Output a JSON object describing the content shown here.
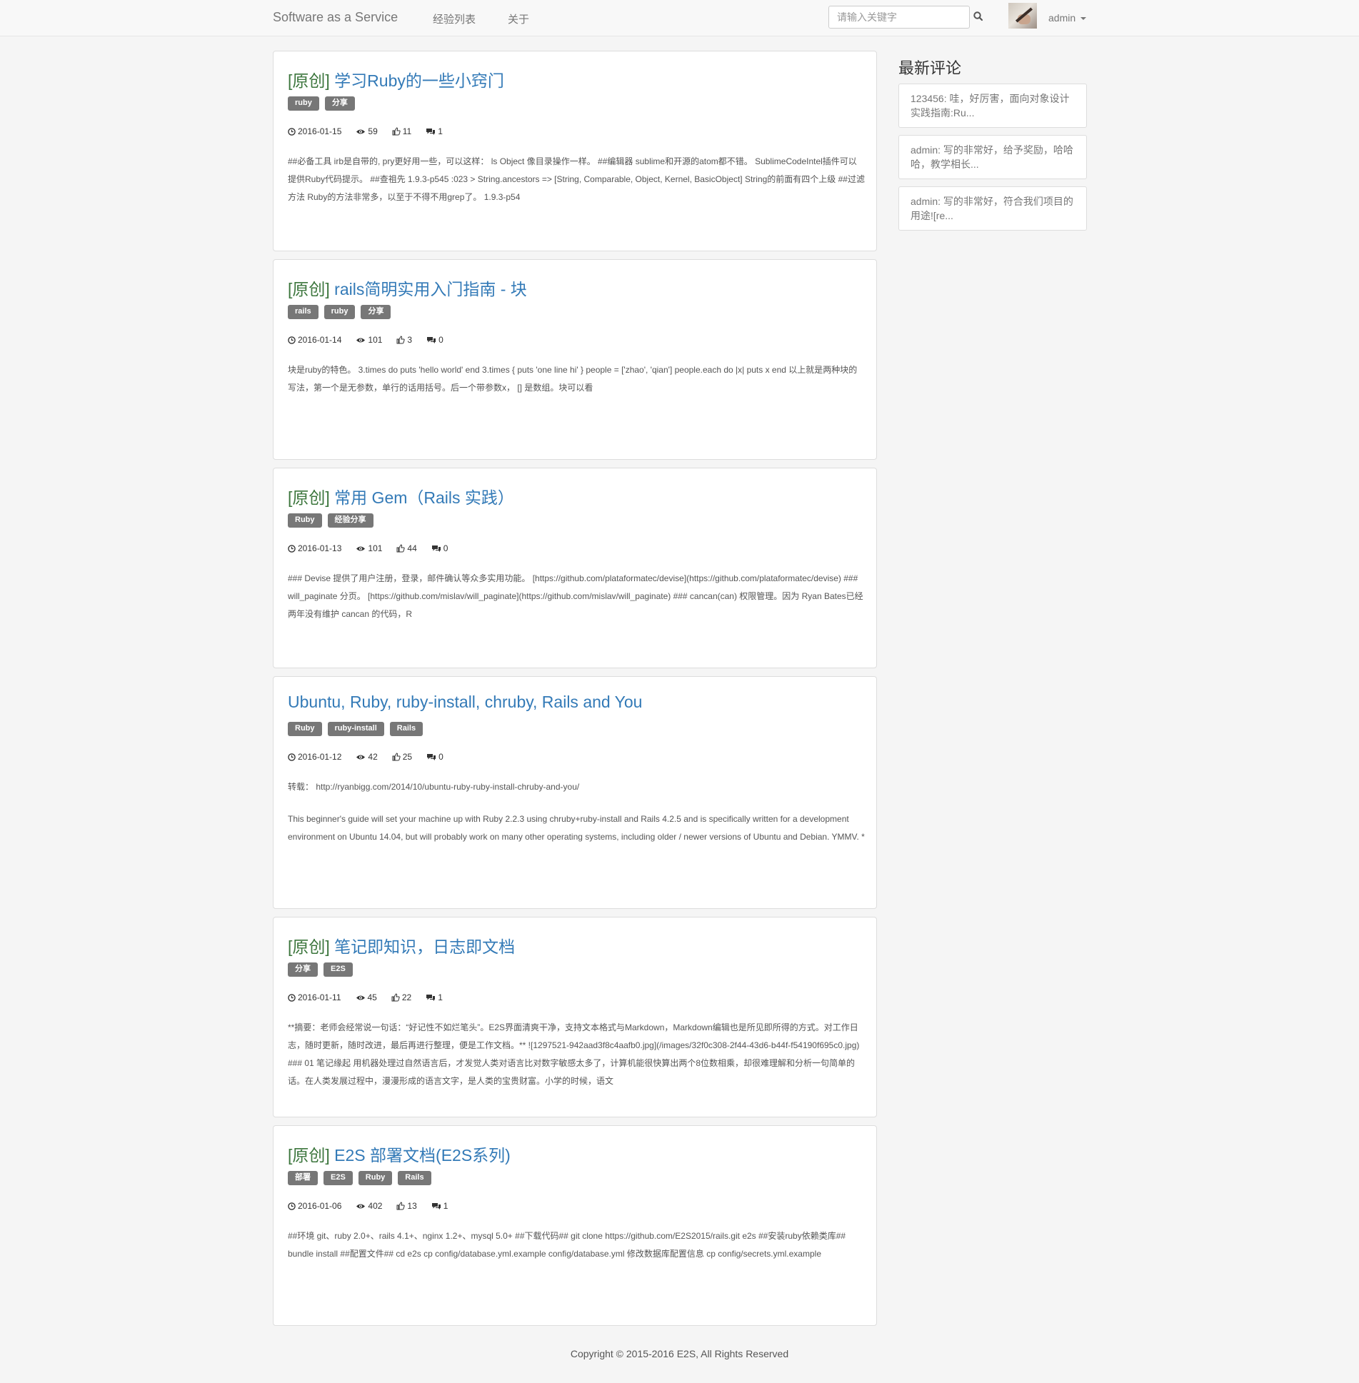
{
  "navbar": {
    "brand": "Software as a Service",
    "links": [
      "经验列表",
      "关于"
    ],
    "search_placeholder": "请输入关键字",
    "user": "admin"
  },
  "posts": [
    {
      "prefix": "[原创]",
      "title": "学习Ruby的一些小窍门",
      "tags": [
        "ruby",
        "分享"
      ],
      "date": "2016-01-15",
      "views": "59",
      "likes": "11",
      "comments": "1",
      "excerpt": [
        "##必备工具 irb是自带的, pry更好用一些，可以这样： ls Object 像目录操作一样。 ##编辑器 sublime和开源的atom都不错。 SublimeCodeIntel插件可以提供Ruby代码提示。 ##查祖先 1.9.3-p545 :023 > String.ancestors => [String, Comparable, Object, Kernel, BasicObject] String的前面有四个上级 ##过滤方法 Ruby的方法非常多，以至于不得不用grep了。 1.9.3-p54"
      ]
    },
    {
      "prefix": "[原创]",
      "title": "rails简明实用入门指南 - 块",
      "tags": [
        "rails",
        "ruby",
        "分享"
      ],
      "date": "2016-01-14",
      "views": "101",
      "likes": "3",
      "comments": "0",
      "excerpt": [
        "块是ruby的特色。 3.times do puts 'hello world' end 3.times { puts 'one line hi' } people = ['zhao', 'qian'] people.each do |x| puts x end 以上就是两种块的写法，第一个是无参数，单行的话用括号。后一个带参数x， [] 是数组。块可以看"
      ]
    },
    {
      "prefix": "[原创]",
      "title": "常用 Gem（Rails 实践）",
      "tags": [
        "Ruby",
        "经验分享"
      ],
      "date": "2016-01-13",
      "views": "101",
      "likes": "44",
      "comments": "0",
      "excerpt": [
        "### Devise 提供了用户注册，登录，邮件确认等众多实用功能。 [https://github.com/plataformatec/devise](https://github.com/plataformatec/devise) ### will_paginate 分页。 [https://github.com/mislav/will_paginate](https://github.com/mislav/will_paginate) ### cancan(can) 权限管理。因为 Ryan Bates已经两年没有维护 cancan 的代码，R"
      ]
    },
    {
      "prefix": "",
      "title": "Ubuntu, Ruby, ruby-install, chruby, Rails and You",
      "tags": [
        "Ruby",
        "ruby-install",
        "Rails"
      ],
      "date": "2016-01-12",
      "views": "42",
      "likes": "25",
      "comments": "0",
      "excerpt": [
        "转载： http://ryanbigg.com/2014/10/ubuntu-ruby-ruby-install-chruby-and-you/",
        "This beginner's guide will set your machine up with Ruby 2.2.3 using chruby+ruby-install and Rails 4.2.5 and is specifically written for a development environment on Ubuntu 14.04, but will probably work on many other operating systems, including older / newer versions of Ubuntu and Debian. YMMV. *"
      ]
    },
    {
      "prefix": "[原创]",
      "title": "笔记即知识，日志即文档",
      "tags": [
        "分享",
        "E2S"
      ],
      "date": "2016-01-11",
      "views": "45",
      "likes": "22",
      "comments": "1",
      "excerpt": [
        "**摘要：老师会经常说一句话：“好记性不如烂笔头”。E2S界面清爽干净，支持文本格式与Markdown，Markdown编辑也是所见即所得的方式。对工作日志，随时更新，随时改进，最后再进行整理，便是工作文档。** ![1297521-942aad3f8c4aafb0.jpg](/images/32f0c308-2f44-43d6-b44f-f54190f695c0.jpg) ### 01 笔记缘起 用机器处理过自然语言后，才发觉人类对语言比对数字敏感太多了，计算机能很快算出两个8位数相乘，却很难理解和分析一句简单的话。在人类发展过程中，漫漫形成的语言文字，是人类的宝贵财富。小学的时候，语文"
      ]
    },
    {
      "prefix": "[原创]",
      "title": "E2S 部署文档(E2S系列)",
      "tags": [
        "部署",
        "E2S",
        "Ruby",
        "Rails"
      ],
      "date": "2016-01-06",
      "views": "402",
      "likes": "13",
      "comments": "1",
      "excerpt": [
        "##环境 git、ruby 2.0+、rails 4.1+、nginx 1.2+、mysql 5.0+ ##下载代码## git clone https://github.com/E2S2015/rails.git e2s ##安装ruby依赖类库## bundle install ##配置文件## cd e2s cp config/database.yml.example config/database.yml 修改数据库配置信息 cp config/secrets.yml.example"
      ]
    }
  ],
  "sidebar": {
    "title": "最新评论",
    "comments": [
      "123456: 哇，好厉害，面向对象设计实践指南:Ru...",
      "admin: 写的非常好，给予奖励，哈哈哈，教学相长...",
      "admin: 写的非常好，符合我们项目的用途![re..."
    ]
  },
  "footer": "Copyright © 2015-2016 E2S, All Rights Reserved"
}
